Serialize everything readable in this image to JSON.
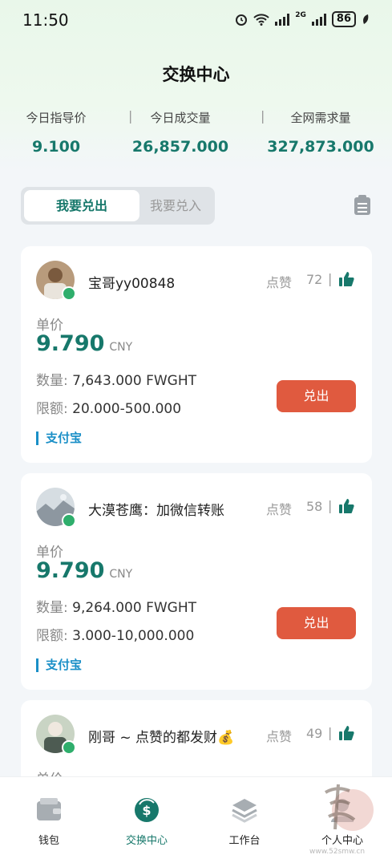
{
  "status_bar": {
    "time": "11:50",
    "network": "2G",
    "battery": "86"
  },
  "header": {
    "title": "交换中心",
    "stats": [
      {
        "label": "今日指导价",
        "value": "9.100"
      },
      {
        "label": "今日成交量",
        "value": "26,857.000"
      },
      {
        "label": "全网需求量",
        "value": "327,873.000"
      }
    ],
    "separator": "|"
  },
  "tabs": {
    "active": "我要兑出",
    "inactive": "我要兑入"
  },
  "listings": [
    {
      "name": "宝哥yy00848",
      "likes_label": "点赞",
      "likes": "72",
      "unit_label": "单价",
      "price": "9.790",
      "currency": "CNY",
      "quantity_label": "数量:",
      "quantity": "7,643.000 FWGHT",
      "limit_label": "限额:",
      "limit": "20.000-500.000",
      "payment": "支付宝",
      "action": "兑出"
    },
    {
      "name": "大漠苍鹰：加微信转账",
      "likes_label": "点赞",
      "likes": "58",
      "unit_label": "单价",
      "price": "9.790",
      "currency": "CNY",
      "quantity_label": "数量:",
      "quantity": "9,264.000 FWGHT",
      "limit_label": "限额:",
      "limit": "3.000-10,000.000",
      "payment": "支付宝",
      "action": "兑出"
    },
    {
      "name": "刚哥 ~ 点赞的都发财💰",
      "likes_label": "点赞",
      "likes": "49",
      "unit_label": "单价"
    }
  ],
  "bottom_nav": [
    {
      "label": "钱包",
      "icon": "wallet-icon"
    },
    {
      "label": "交换中心",
      "icon": "exchange-icon",
      "active": true
    },
    {
      "label": "工作台",
      "icon": "layers-icon"
    },
    {
      "label": "个人中心",
      "icon": "user-icon"
    }
  ],
  "watermark": {
    "url": "www.52smw.cn"
  },
  "colors": {
    "accent": "#17786b",
    "sell_button": "#e05a3f",
    "online": "#2fae6c",
    "payment": "#1a8fc7"
  }
}
